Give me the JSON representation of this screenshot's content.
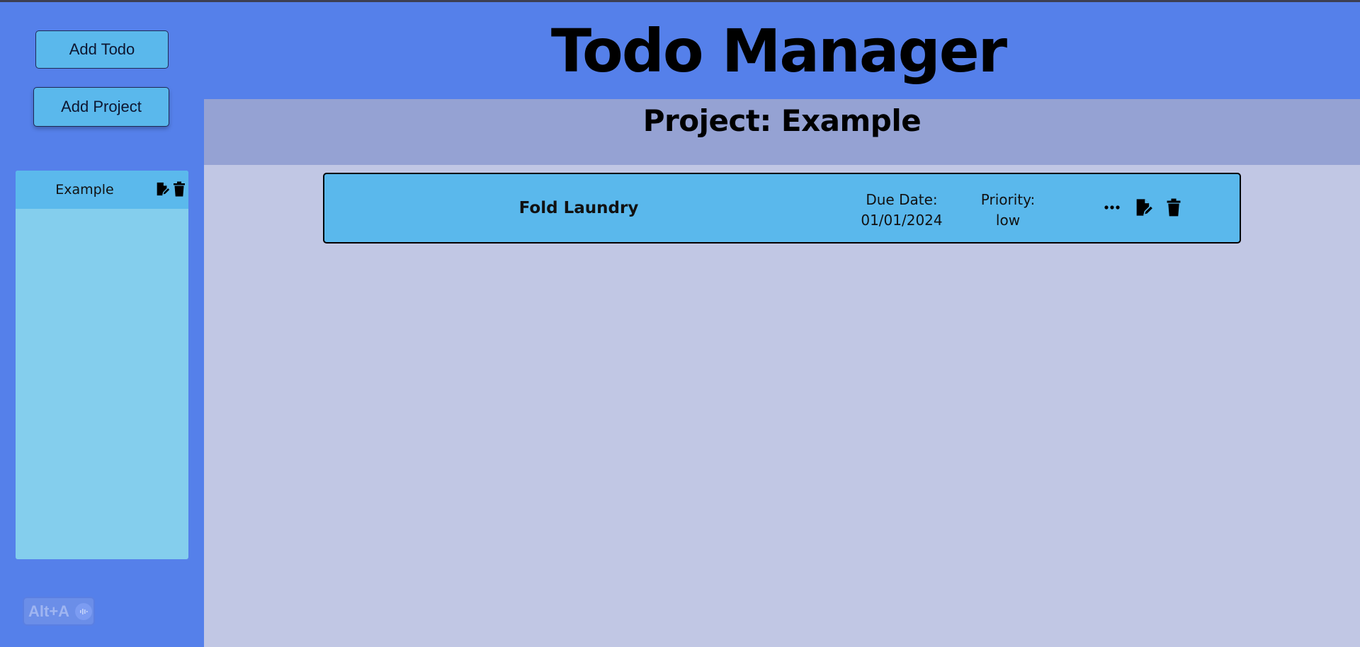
{
  "app": {
    "title": "Todo Manager"
  },
  "sidebar": {
    "add_todo_label": "Add Todo",
    "add_project_label": "Add Project",
    "projects": [
      {
        "label": "Example",
        "icons": [
          "edit-icon",
          "trash-icon"
        ]
      }
    ],
    "shortcut_badge": "Alt+A"
  },
  "main": {
    "project_heading": "Project: Example",
    "todos": [
      {
        "title": "Fold Laundry",
        "due_label": "Due Date:",
        "due_value": "01/01/2024",
        "priority_label": "Priority:",
        "priority_value": "low",
        "icons": [
          "more-icon",
          "edit-icon",
          "trash-icon"
        ]
      }
    ]
  },
  "colors": {
    "background": "#5580ea",
    "button": "#5ab8ec",
    "project_list": "#84ceed",
    "project_header": "#95a2d3",
    "content": "#c1c7e4"
  }
}
